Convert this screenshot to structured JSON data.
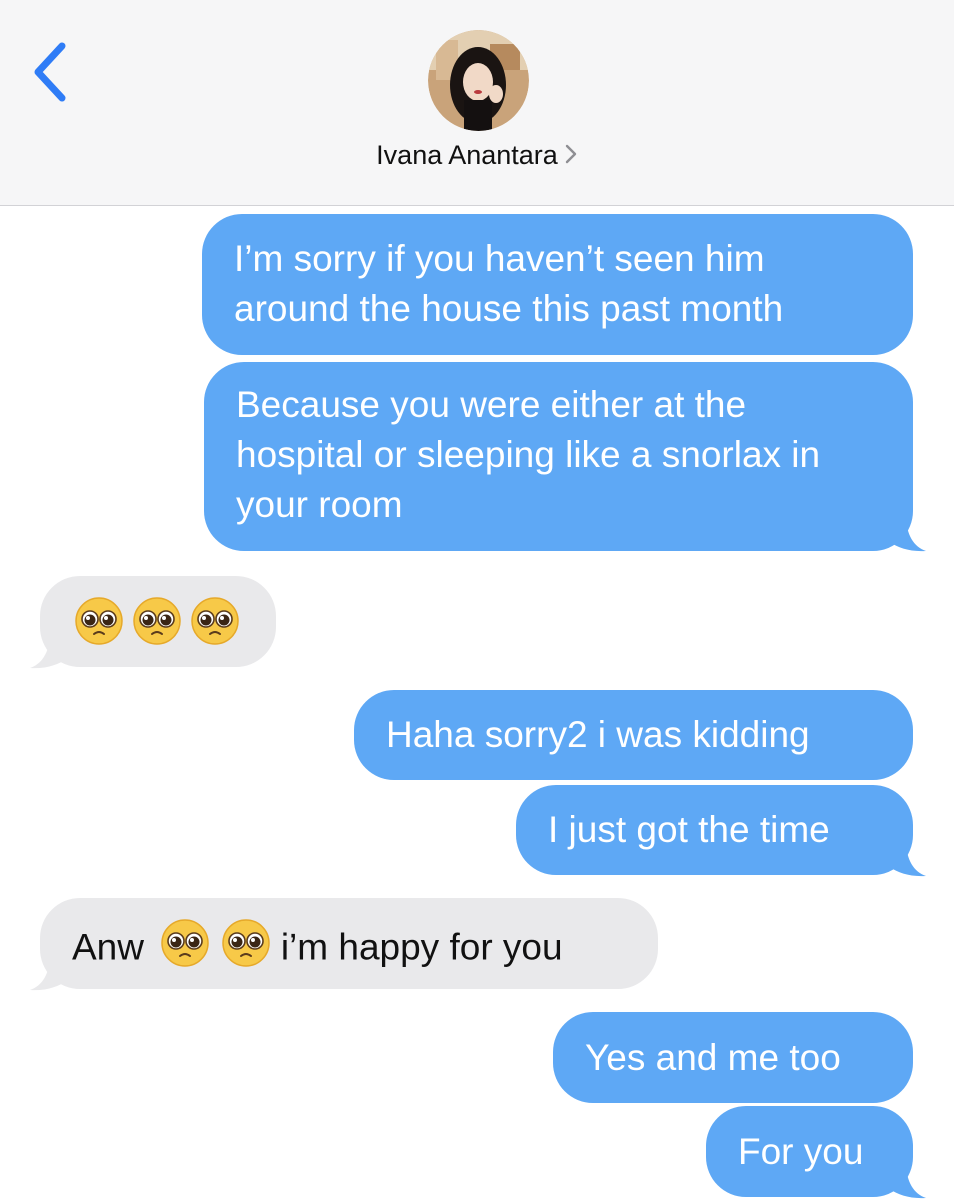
{
  "colors": {
    "sent_bubble": "#5ea8f5",
    "received_bubble": "#e9e9eb",
    "accent": "#2f7cf6",
    "header_bg": "#f6f6f7"
  },
  "header": {
    "back_icon": "chevron-left-icon",
    "contact_name": "Ivana Anantara",
    "contact_chevron_icon": "chevron-right-icon"
  },
  "messages": [
    {
      "side": "sent",
      "text": "I’m sorry if you haven’t seen him around the house this past month"
    },
    {
      "side": "sent",
      "text": "Because you were either at the hospital or sleeping like a snorlax in your room"
    },
    {
      "side": "received",
      "emoji": "pleading-face-emoji",
      "count": 3
    },
    {
      "side": "sent",
      "text": "Haha sorry2 i was kidding"
    },
    {
      "side": "sent",
      "text": "I just got the time"
    },
    {
      "side": "received",
      "text_before": "Anw",
      "emoji": "pleading-face-emoji",
      "count": 2,
      "text_after": "i’m happy for you"
    },
    {
      "side": "sent",
      "text": "Yes and me too"
    },
    {
      "side": "sent",
      "text": "For you"
    }
  ]
}
